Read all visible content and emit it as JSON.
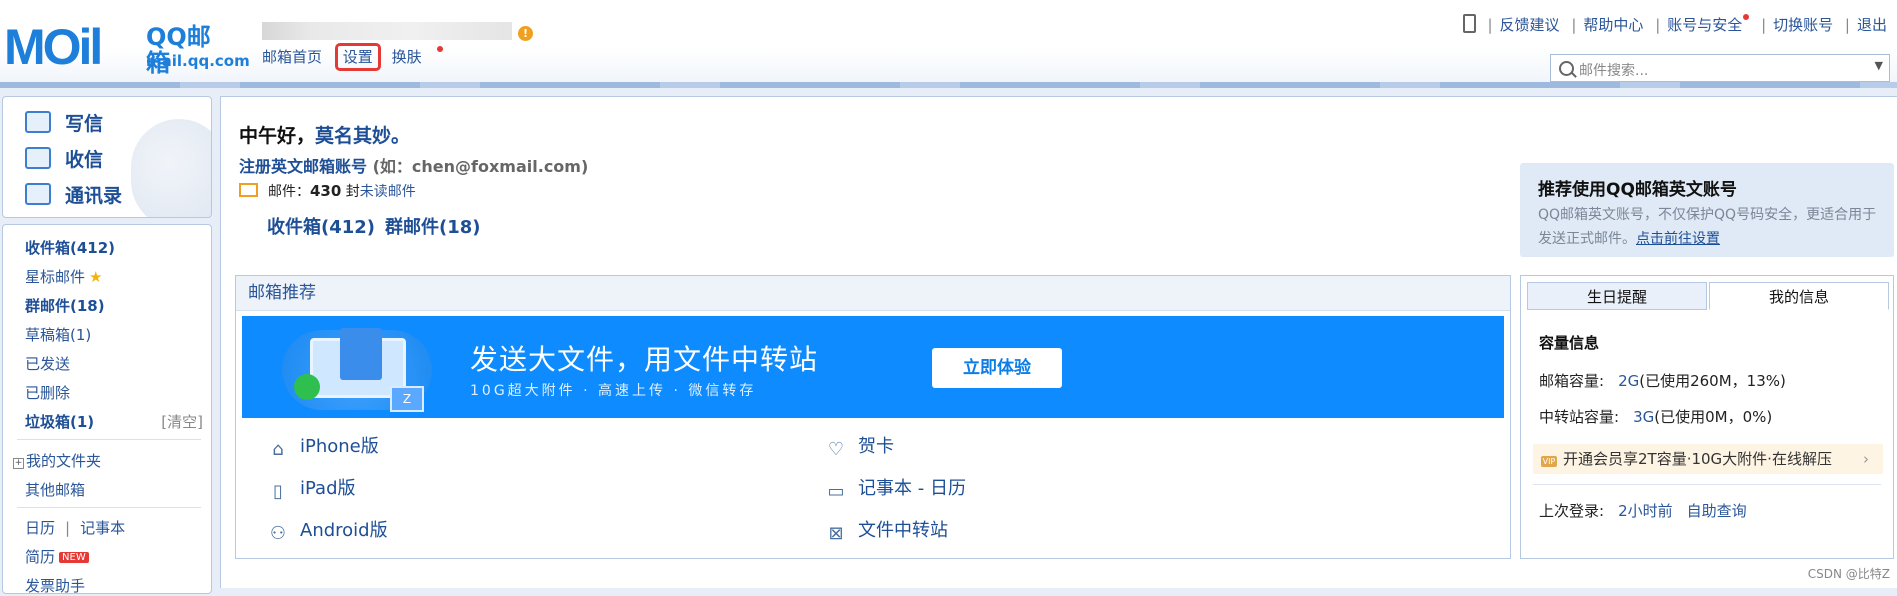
{
  "header": {
    "logo_main": "MOil",
    "logo_cn": "QQ邮箱",
    "logo_url": "mail.qq.com",
    "warn": "!",
    "nav": [
      "邮箱首页",
      "设置",
      "换肤"
    ],
    "links": [
      "反馈建议",
      "帮助中心",
      "账号与安全",
      "切换账号",
      "退出"
    ],
    "search_placeholder": "邮件搜索..."
  },
  "sidebar": {
    "actions": [
      "写信",
      "收信",
      "通讯录"
    ],
    "folders": {
      "inbox": "收件箱(412)",
      "starred": "星标邮件",
      "group": "群邮件(18)",
      "drafts": "草稿箱(1)",
      "sent": "已发送",
      "deleted": "已删除",
      "junk": "垃圾箱(1)",
      "clear": "[清空]",
      "my_folders": "我的文件夹",
      "other": "其他邮箱",
      "calendar": "日历",
      "notes": "记事本",
      "resume": "简历",
      "resume_badge": "NEW",
      "invoice": "发票助手"
    }
  },
  "main": {
    "greeting_prefix": "中午好，",
    "nickname": "莫名其妙。",
    "register": "注册英文邮箱账号",
    "register_example": "(如：chen@foxmail.com)",
    "mail_label": "邮件：",
    "mail_count": "430",
    "mail_unit": "封",
    "unread": "未读邮件",
    "inbox_count": "收件箱(412)",
    "group_count": "群邮件(18)",
    "rec_title": "邮箱推荐",
    "banner": {
      "headline": "发送大文件，用文件中转站",
      "sub": "10G超大附件 · 高速上传 · 微信转存",
      "button": "立即体验"
    },
    "rec_items": [
      "iPhone版",
      "iPad版",
      "Android版",
      "贺卡",
      "记事本 - 日历",
      "文件中转站"
    ]
  },
  "promo": {
    "title": "推荐使用QQ邮箱英文账号",
    "desc": "QQ邮箱英文账号，不仅保护QQ号码安全，更适合用于发送正式邮件。",
    "link": "点击前往设置"
  },
  "info": {
    "tabs": [
      "生日提醒",
      "我的信息"
    ],
    "capacity_title": "容量信息",
    "mailbox_label": "邮箱容量:",
    "mailbox_value": "2G",
    "mailbox_detail": "(已使用260M，13%)",
    "transfer_label": "中转站容量:",
    "transfer_value": "3G",
    "transfer_detail": "(已使用0M，0%)",
    "vip_badge": "VIP",
    "vip_text": "开通会员享2T容量·10G大附件·在线解压",
    "last_login_label": "上次登录:",
    "last_login_value": "2小时前",
    "self_query": "自助查询"
  },
  "watermark": "CSDN @比特Z"
}
